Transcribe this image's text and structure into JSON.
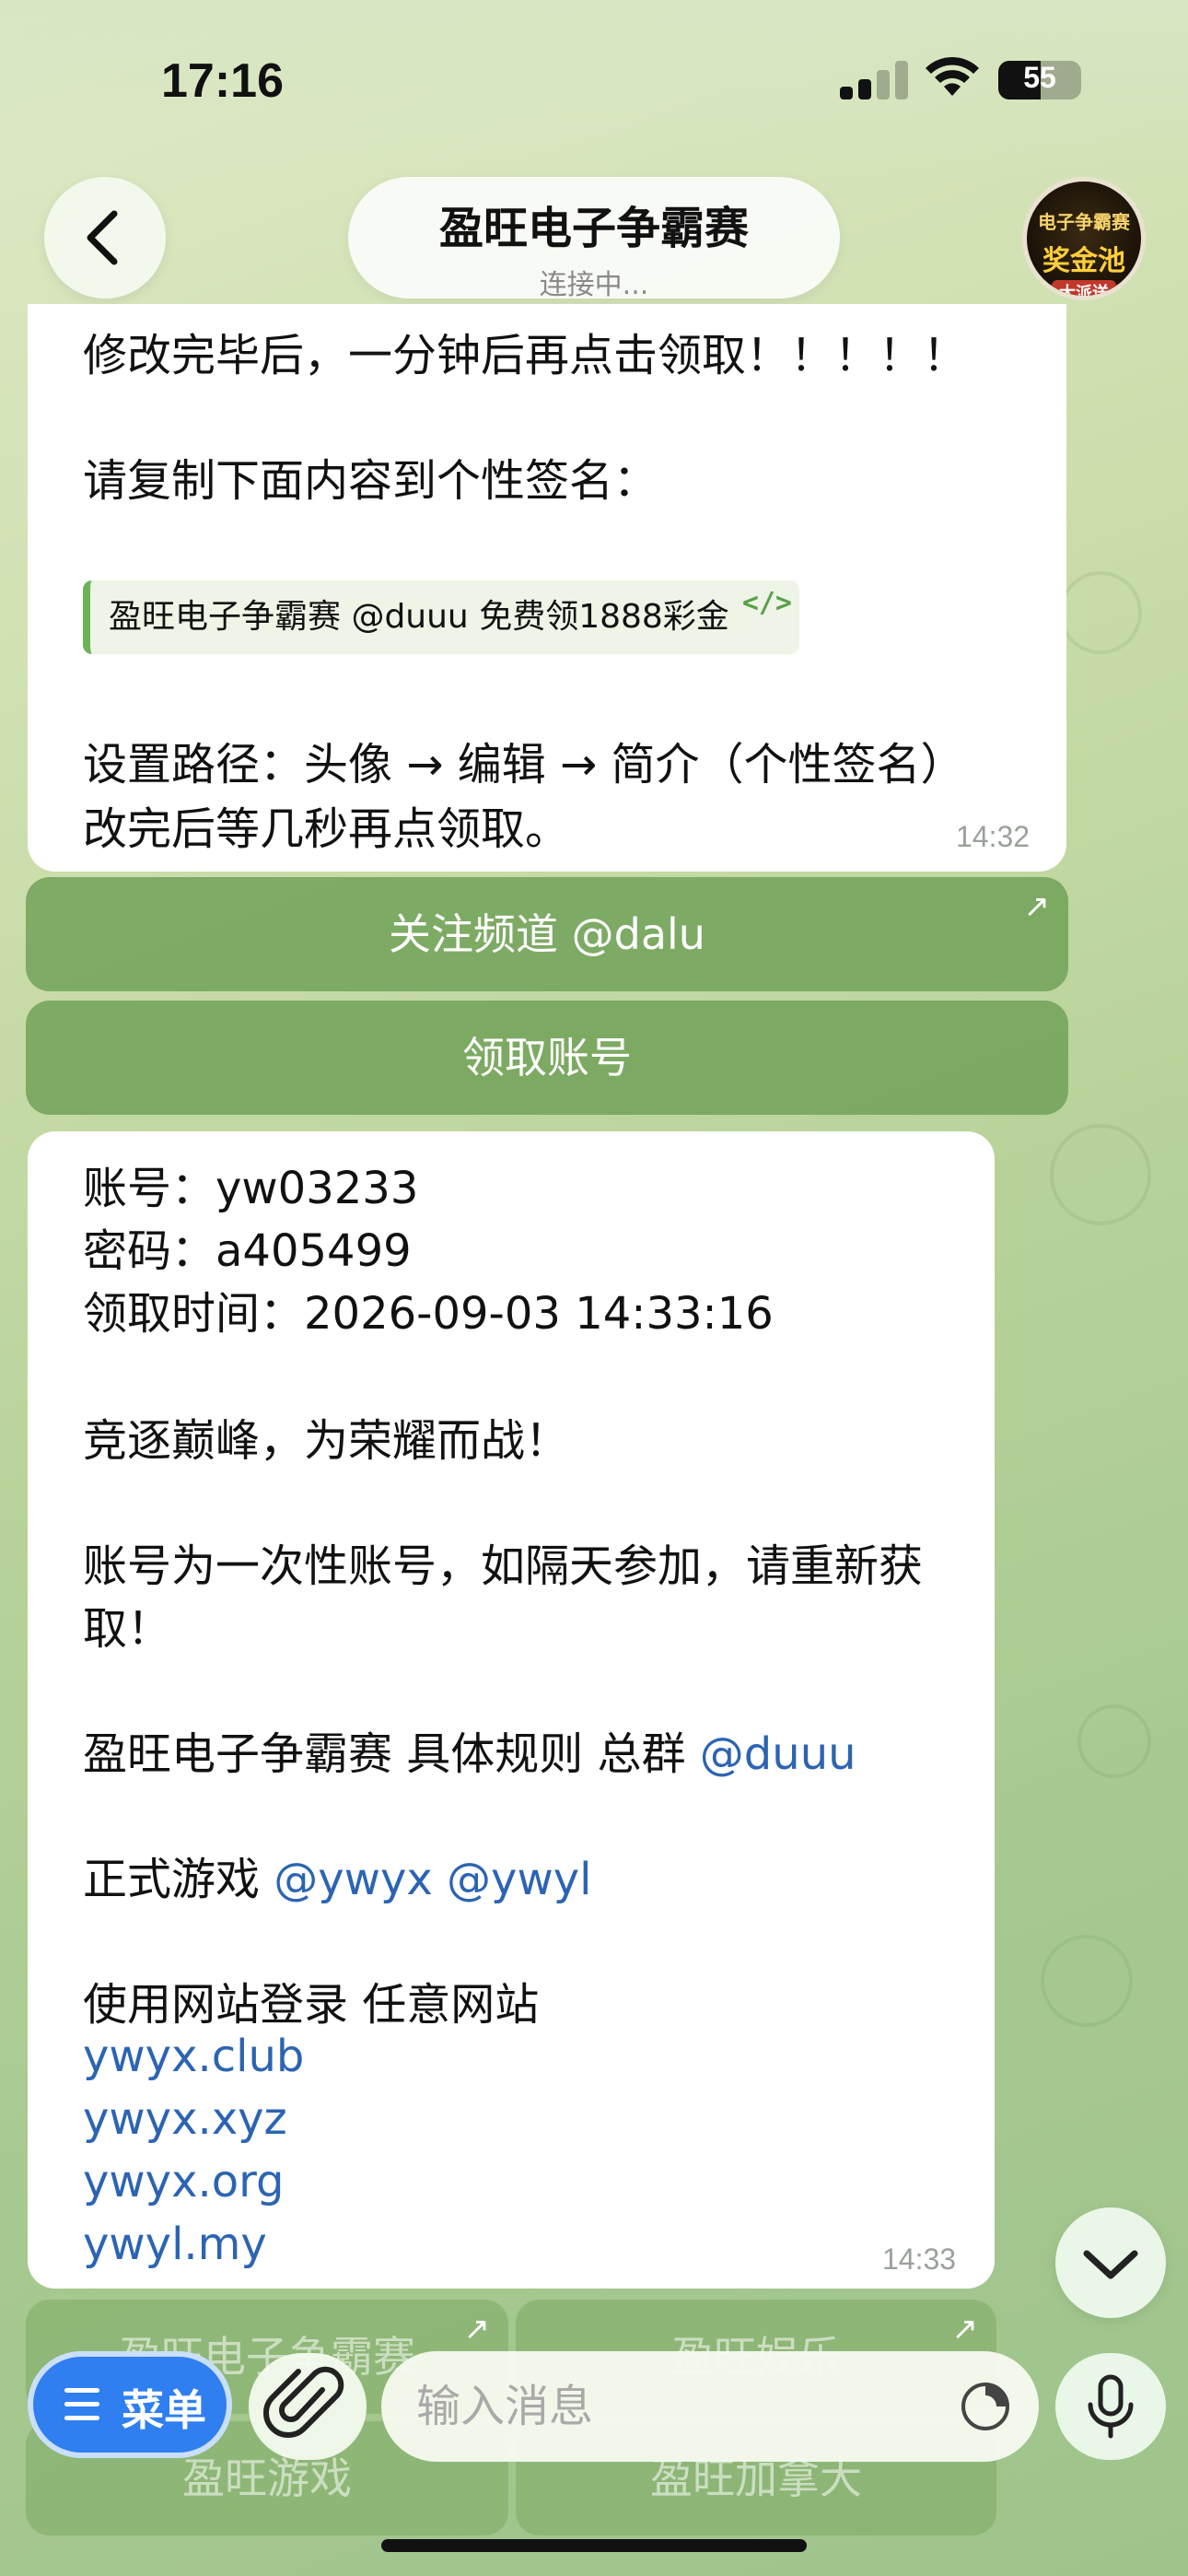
{
  "status_bar": {
    "time": "17:16",
    "battery": "55"
  },
  "header": {
    "title": "盈旺电子争霸赛",
    "subtitle": "连接中...",
    "avatar": {
      "line1": "电子争霸赛",
      "line2": "奖金池",
      "line3": "大派送"
    }
  },
  "message1": {
    "lines": [
      "修改完毕后，一分钟后再点击领取！！！！！",
      "请复制下面内容到个性签名：",
      "设置路径：头像 → 编辑 → 简介（个性签名）",
      "改完后等几秒再点领取。"
    ],
    "code": "盈旺电子争霸赛 @duuu 免费领1888彩金",
    "time": "14:32"
  },
  "buttons1": {
    "follow": "关注频道 @dalu",
    "claim": "领取账号"
  },
  "message2": {
    "account": "账号：yw03233",
    "password": "密码：a405499",
    "claim_time": "领取时间：2026-09-03 14:33:16",
    "slogan": "竞逐巅峰，为荣耀而战！",
    "note_line1": "账号为一次性账号，如隔天参加，请重新获",
    "note_line2": "取！",
    "rules_text": "盈旺电子争霸赛 具体规则 总群",
    "rules_link": "@duuu",
    "games_text": "正式游戏",
    "games_link1": "@ywyx",
    "games_link2": "@ywyl",
    "login_text": "使用网站登录 任意网站",
    "sites": [
      "ywyx.club",
      "ywyx.xyz",
      "ywyx.org",
      "ywyl.my"
    ],
    "time": "14:33"
  },
  "buttons2": [
    "盈旺电子争霸赛",
    "盈旺娱乐",
    "盈旺游戏",
    "盈旺加拿大"
  ],
  "input_bar": {
    "menu_label": "菜单",
    "placeholder": "输入消息"
  },
  "colors": {
    "link": "#2c64b3",
    "menu_button": "#2f7ff0",
    "inline_button": "#6ea055"
  }
}
